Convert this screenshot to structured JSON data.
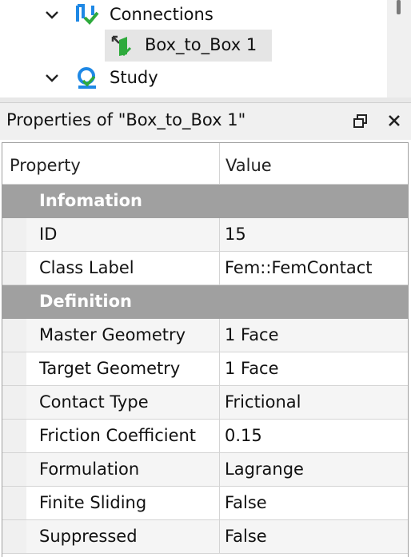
{
  "tree": {
    "items": [
      {
        "label": "Connections",
        "expanded": true,
        "icon": "connections-icon"
      },
      {
        "label": "Box_to_Box 1",
        "selected": true,
        "icon": "contact-icon"
      },
      {
        "label": "Study",
        "expanded": true,
        "icon": "study-icon"
      }
    ]
  },
  "panel": {
    "title": "Properties of \"Box_to_Box 1\"",
    "float_icon": "float-window-icon",
    "close_icon": "close-icon"
  },
  "table": {
    "headers": {
      "property": "Property",
      "value": "Value"
    },
    "groups": [
      {
        "name": "Infomation",
        "rows": [
          {
            "property": "ID",
            "value": "15"
          },
          {
            "property": "Class Label",
            "value": "Fem::FemContact"
          }
        ]
      },
      {
        "name": "Definition",
        "rows": [
          {
            "property": "Master Geometry",
            "value": "1 Face"
          },
          {
            "property": "Target Geometry",
            "value": "1 Face"
          },
          {
            "property": "Contact Type",
            "value": "Frictional"
          },
          {
            "property": "Friction Coefficient",
            "value": "0.15"
          },
          {
            "property": "Formulation",
            "value": "Lagrange"
          },
          {
            "property": "Finite Sliding",
            "value": "False"
          },
          {
            "property": "Suppressed",
            "value": "False"
          }
        ]
      }
    ]
  },
  "colors": {
    "group_header": "#a0a0a0",
    "selection": "#e5e5e5",
    "icon_blue": "#1e88e5",
    "icon_green": "#2eaa3c"
  }
}
